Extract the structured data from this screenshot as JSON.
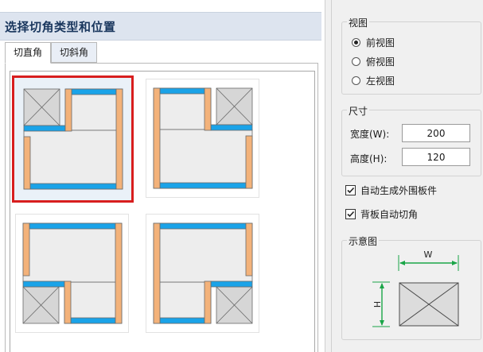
{
  "left_panel": {
    "title": "选择切角类型和位置",
    "tabs": [
      {
        "label": "切直角",
        "active": true
      },
      {
        "label": "切斜角",
        "active": false
      }
    ],
    "options": [
      {
        "id": "top-left",
        "selected": true
      },
      {
        "id": "top-right",
        "selected": false
      },
      {
        "id": "bottom-left",
        "selected": false
      },
      {
        "id": "bottom-right",
        "selected": false
      }
    ]
  },
  "view_group": {
    "title": "视图",
    "options": [
      {
        "label": "前视图",
        "checked": true
      },
      {
        "label": "俯视图",
        "checked": false
      },
      {
        "label": "左视图",
        "checked": false
      }
    ]
  },
  "size_group": {
    "title": "尺寸",
    "width_label": "宽度(W):",
    "width_value": "200",
    "height_label": "高度(H):",
    "height_value": "120"
  },
  "checkboxes": [
    {
      "label": "自动生成外围板件",
      "checked": true
    },
    {
      "label": "背板自动切角",
      "checked": true
    }
  ],
  "diagram_group": {
    "title": "示意图",
    "w_label": "W",
    "h_label": "H"
  },
  "colors": {
    "selection_border": "#d81e1e",
    "blue_panel": "#1aa3e8",
    "orange_panel": "#f3b27a",
    "gray_box": "#d6d6d6",
    "dimension_green": "#1aa548"
  }
}
